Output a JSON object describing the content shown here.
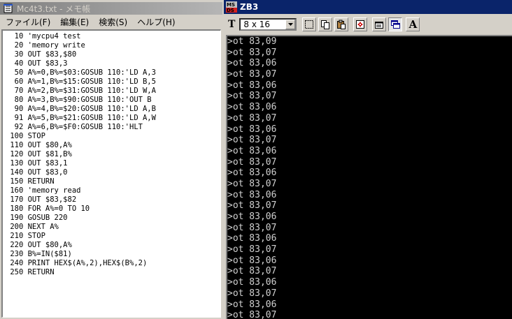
{
  "notepad": {
    "title": "Mc4t3.txt - メモ帳",
    "menu": [
      "ファイル(F)",
      "編集(E)",
      "検索(S)",
      "ヘルプ(H)"
    ],
    "lines": [
      "  10 'mycpu4 test",
      "  20 'memory write",
      "  30 OUT $83,$80",
      "  40 OUT $83,3",
      "  50 A%=0,B%=$03:GOSUB 110:'LD A,3",
      "  60 A%=1,B%=$15:GOSUB 110:'LD B,5",
      "  70 A%=2,B%=$31:GOSUB 110:'LD W,A",
      "  80 A%=3,B%=$90:GOSUB 110:'OUT B",
      "  90 A%=4,B%=$20:GOSUB 110:'LD A,B",
      "  91 A%=5,B%=$21:GOSUB 110:'LD A,W",
      "  92 A%=6,B%=$F0:GOSUB 110:'HLT",
      " 100 STOP",
      " 110 OUT $80,A%",
      " 120 OUT $81,B%",
      " 130 OUT $83,1",
      " 140 OUT $83,0",
      " 150 RETURN",
      " 160 'memory read",
      " 170 OUT $83,$82",
      " 180 FOR A%=0 TO 10",
      " 190 GOSUB 220",
      " 200 NEXT A%",
      " 210 STOP",
      " 220 OUT $80,A%",
      " 230 B%=IN($81)",
      " 240 PRINT HEX$(A%,2),HEX$(B%,2)",
      " 250 RETURN"
    ]
  },
  "zb3": {
    "title": "ZB3",
    "icon_text_top": "MS",
    "icon_text_bottom": "DS",
    "font_size_value": "8 x 16",
    "font_icon": "T",
    "toolbar_icons": [
      "select-icon",
      "copy-icon",
      "paste-icon",
      "fit-window-icon",
      "properties-icon",
      "window-icon",
      "font-icon"
    ],
    "font_button_label": "A",
    "terminal_lines": [
      ">ot 83,09",
      ">ot 83,07",
      ">ot 83,06",
      ">ot 83,07",
      ">ot 83,06",
      ">ot 83,07",
      ">ot 83,06",
      ">ot 83,07",
      ">ot 83,06",
      ">ot 83,07",
      ">ot 83,06",
      ">ot 83,07",
      ">ot 83,06",
      ">ot 83,07",
      ">ot 83,06",
      ">ot 83,07",
      ">ot 83,06",
      ">ot 83,07",
      ">ot 83,06",
      ">ot 83,07",
      ">ot 83,06",
      ">ot 83,07",
      ">ot 83,06",
      ">ot 83,07",
      ">ot 83,06",
      ">ot 83,07",
      ">"
    ]
  },
  "colors": {
    "active_title": "#0a246a",
    "inactive_title": "#808080",
    "terminal_bg": "#000000",
    "terminal_fg": "#d0d0d0"
  }
}
